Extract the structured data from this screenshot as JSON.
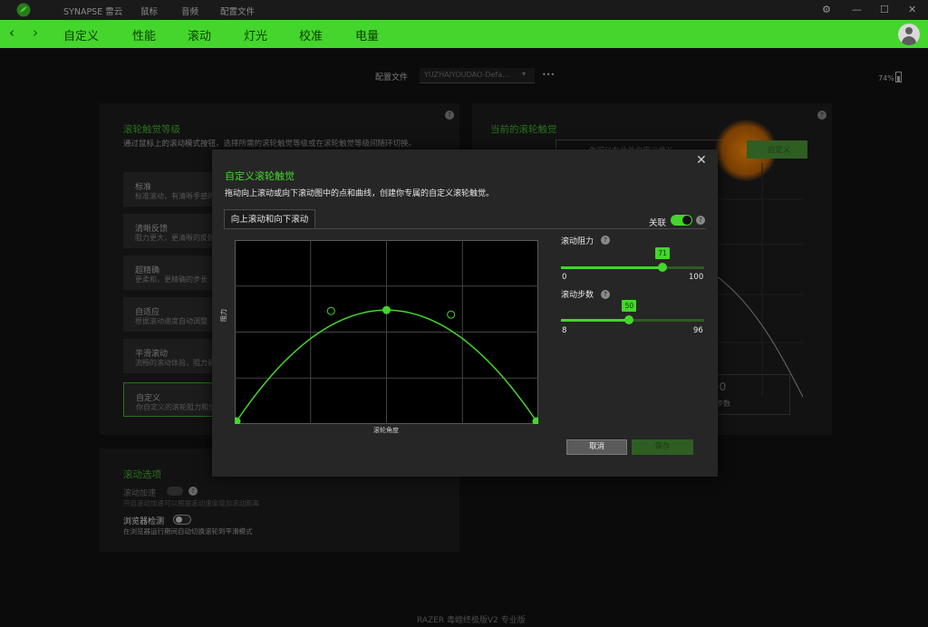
{
  "titlebar": {
    "nav": [
      "SYNAPSE 雷云",
      "鼠标",
      "音频",
      "配置文件"
    ],
    "controls": [
      "⚙",
      "—",
      "☐",
      "✕"
    ]
  },
  "nav": {
    "back": "‹",
    "forward": "›",
    "tabs": [
      "自定义",
      "性能",
      "滚动",
      "灯光",
      "校准",
      "电量"
    ],
    "active_tab": "滚动"
  },
  "profile": {
    "label": "配置文件",
    "value": "YUZHAIYOUDAO-Defa...",
    "more": "•••"
  },
  "battery": {
    "percent": "74%"
  },
  "left_panel": {
    "title": "滚轮触觉等级",
    "desc": "通过鼠标上的滚动模式按钮，选择所需的滚轮触觉等级或在滚轮触觉等级间随环切换。",
    "items": [
      {
        "title": "标准",
        "sub": "标准滚动，有清晰手感的分段"
      },
      {
        "title": "清晰反馈",
        "sub": "阻力更大，更清晰的反馈"
      },
      {
        "title": "超精确",
        "sub": "更柔和，更精确的步长"
      },
      {
        "title": "自适应",
        "sub": "根据滚动速度自动调整"
      },
      {
        "title": "平滑滚动",
        "sub": "流畅的滚动体验，阻力最小"
      },
      {
        "title": "自定义",
        "sub": "你自定义的滚轮阻力和步长"
      }
    ]
  },
  "right_panel": {
    "title": "当前的滚轮触觉",
    "hint": "你可以在此处自定义步长",
    "button": "自定义",
    "big_value": "50",
    "big_label": "步数"
  },
  "scroll_options": {
    "title": "滚动选项",
    "items": [
      {
        "title": "滚动加速",
        "sub": "开启滚动加速可以根据滚动速度增加滚动距离"
      },
      {
        "title": "浏览器检测",
        "sub": "在浏览器运行期间自动切换滚轮到平滑模式"
      }
    ]
  },
  "footer": {
    "device": "RAZER 毒蝰终极版V2 专业版"
  },
  "dialog": {
    "title": "自定义滚轮触觉",
    "desc": "拖动向上滚动或向下滚动图中的点和曲线，创建你专属的自定义滚轮触觉。",
    "close": "✕",
    "tab": "向上滚动和向下滚动",
    "link_label": "关联",
    "y_axis": "阻力",
    "x_axis": "滚轮角度",
    "curve_points": [
      [
        0,
        0
      ],
      [
        0.5,
        0.62
      ],
      [
        1,
        0
      ]
    ],
    "control_points": [
      [
        0.315,
        0.615
      ],
      [
        0.715,
        0.595
      ]
    ],
    "sliders": [
      {
        "label": "滚动阻力",
        "value": "71",
        "min": "0",
        "max": "100",
        "numeric": 71,
        "min_n": 0,
        "max_n": 100
      },
      {
        "label": "滚动步数",
        "value": "50",
        "min": "8",
        "max": "96",
        "numeric": 50,
        "min_n": 8,
        "max_n": 96
      }
    ],
    "cancel": "取消",
    "save": "保存"
  },
  "colors": {
    "accent": "#44d62c",
    "panel": "#121212",
    "dialog": "#262626"
  }
}
